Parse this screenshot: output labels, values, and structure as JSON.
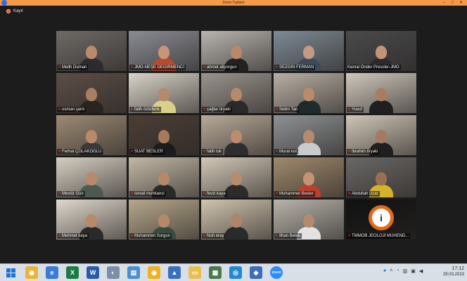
{
  "window": {
    "title": "Zoom Toplantı",
    "controls": [
      "–",
      "□",
      "✕"
    ]
  },
  "meeting": {
    "recording_label": "Kayıt",
    "participants": [
      {
        "name": "Melih Duman",
        "muted": true,
        "active": false,
        "bg": "#6e6a66",
        "body": "#2c2c2e",
        "skin": "#b88a6e"
      },
      {
        "name": "JMO-NEŞE DEĞİRMENCİ",
        "muted": true,
        "active": false,
        "bg": "#8a8c94",
        "body": "#b84a2e",
        "skin": "#c99578"
      },
      {
        "name": "ahmet aliyorgun",
        "muted": true,
        "active": false,
        "bg": "#b8b4ae",
        "body": "#222222",
        "skin": "#b9886a"
      },
      {
        "name": "SEZGİN FERMAN",
        "muted": true,
        "active": false,
        "bg": "#7d8a94",
        "body": "#3c4a5c",
        "skin": "#c39b82"
      },
      {
        "name": "Kemal Önder Prescler-JMO",
        "muted": false,
        "active": true,
        "bg": "#4a4a4c",
        "body": "#2b2b2e",
        "skin": "#c49478"
      },
      {
        "name": "osman şanlı",
        "muted": true,
        "active": false,
        "bg": "#5c4e46",
        "body": "#2a2420",
        "skin": "#a97e62"
      },
      {
        "name": "fatih öztüfenk",
        "muted": true,
        "active": false,
        "bg": "#d8d4c8",
        "body": "#d9d08a",
        "skin": "#b48a6c"
      },
      {
        "name": "çağlar tiryaki",
        "muted": true,
        "active": false,
        "bg": "#9a948c",
        "body": "#2a2a2a",
        "skin": "#b58a6a"
      },
      {
        "name": "Selim Tan",
        "muted": true,
        "active": false,
        "bg": "#b9b0a4",
        "body": "#1f2a2c",
        "skin": "#b88b6c"
      },
      {
        "name": "Yusuf",
        "muted": true,
        "active": false,
        "bg": "#cfc8bc",
        "body": "#1f1f1f",
        "skin": "#a97c60"
      },
      {
        "name": "Ferhat ÇOLAKOĞLU",
        "muted": true,
        "active": false,
        "bg": "#9c8a74",
        "body": "#3a3a3a",
        "skin": "#b88a6a"
      },
      {
        "name": "SUAT BESLER",
        "muted": true,
        "active": false,
        "bg": "#4c3e36",
        "body": "#1c1c1c",
        "skin": "#a77a5c"
      },
      {
        "name": "fatih tok",
        "muted": true,
        "active": false,
        "bg": "#b8aa98",
        "body": "#2e2e2e",
        "skin": "#ba8c6c"
      },
      {
        "name": "Murat kol",
        "muted": true,
        "active": false,
        "bg": "#8e9294",
        "body": "#c9ccce",
        "skin": "#b58a6e"
      },
      {
        "name": "İbrahim tiryaki",
        "muted": true,
        "active": false,
        "bg": "#cfc6b6",
        "body": "#1f1f1f",
        "skin": "#a57a5e"
      },
      {
        "name": "Mevlüt Gün",
        "muted": true,
        "active": false,
        "bg": "#d6cfc2",
        "body": "#4c5a52",
        "skin": "#b78a6c"
      },
      {
        "name": "ismail muhkanci",
        "muted": true,
        "active": false,
        "bg": "#c2b8a6",
        "body": "#2a2a2a",
        "skin": "#b48868"
      },
      {
        "name": "fevzi kaya",
        "muted": true,
        "active": false,
        "bg": "#d2c8b8",
        "body": "#2c2c2c",
        "skin": "#b78b6b"
      },
      {
        "name": "Muhammet Besler",
        "muted": true,
        "active": false,
        "bg": "#a08a6c",
        "body": "#b8402e",
        "skin": "#c29474"
      },
      {
        "name": "Abdullah Ucar",
        "muted": true,
        "active": false,
        "bg": "#6a6866",
        "body": "#d4b22c",
        "skin": "#9a6e52"
      },
      {
        "name": "Mehmet kaya",
        "muted": true,
        "active": false,
        "bg": "#e0d8cc",
        "body": "#2a2a2a",
        "skin": "#b9896a"
      },
      {
        "name": "Muhammet Sorgun",
        "muted": true,
        "active": false,
        "bg": "#b6a88c",
        "body": "#3a4a3e",
        "skin": "#b48868"
      },
      {
        "name": "Nuh eray",
        "muted": true,
        "active": false,
        "bg": "#d0c4ae",
        "body": "#2a2a2a",
        "skin": "#b08466"
      },
      {
        "name": "İlhan Belek",
        "muted": true,
        "active": false,
        "bg": "#b8b4ac",
        "body": "#e2e2e2",
        "skin": "#b48a6c"
      },
      {
        "name": "TMMOB JEOLOJİ MÜHEND...",
        "muted": true,
        "active": false,
        "bg": "#111111",
        "body": "#111111",
        "skin": "#111111",
        "logo": true
      }
    ]
  },
  "taskbar": {
    "start_icon": "windows-start-icon",
    "apps": [
      {
        "icon": "chrome-icon",
        "color": "#e8b43a",
        "glyph": "◉"
      },
      {
        "icon": "internet-explorer-icon",
        "color": "#3a7bd5",
        "glyph": "e"
      },
      {
        "icon": "excel-icon",
        "color": "#1e7a45",
        "glyph": "X"
      },
      {
        "icon": "word-icon",
        "color": "#2b5aa8",
        "glyph": "W"
      },
      {
        "icon": "media-player-icon",
        "color": "#7c8fa8",
        "glyph": "◐"
      },
      {
        "icon": "notes-icon",
        "color": "#4a8fd0",
        "glyph": "▤"
      },
      {
        "icon": "chrome-canary-icon",
        "color": "#f0b020",
        "glyph": "◉"
      },
      {
        "icon": "upload-icon",
        "color": "#3a6fc0",
        "glyph": "▲"
      },
      {
        "icon": "file-explorer-icon",
        "color": "#e8c050",
        "glyph": "▭"
      },
      {
        "icon": "network-app-icon",
        "color": "#4a7a4a",
        "glyph": "▦"
      },
      {
        "icon": "edge-icon",
        "color": "#1f8ad0",
        "glyph": "◎"
      },
      {
        "icon": "outlook-icon",
        "color": "#3d6fb8",
        "glyph": "◆"
      },
      {
        "icon": "zoom-icon",
        "color": "#2d8cff",
        "glyph": "zoom"
      }
    ],
    "time": "17:12",
    "date": "29.03.2023"
  }
}
